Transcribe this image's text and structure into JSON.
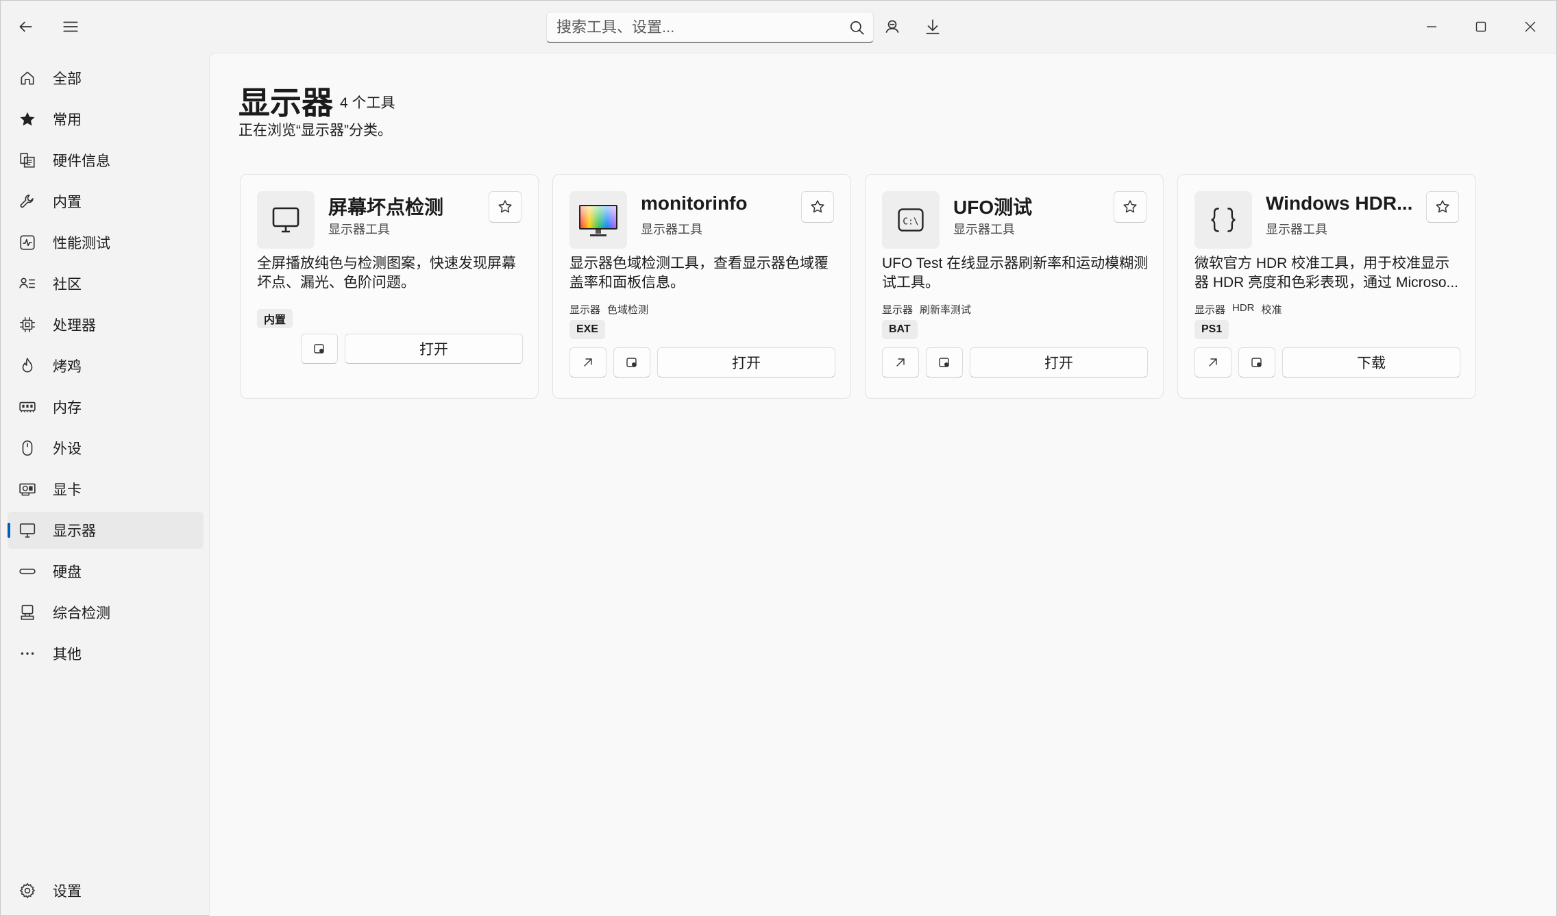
{
  "search": {
    "placeholder": "搜索工具、设置..."
  },
  "sidebar": {
    "items": [
      {
        "label": "全部",
        "icon": "home-icon"
      },
      {
        "label": "常用",
        "icon": "star-icon"
      },
      {
        "label": "硬件信息",
        "icon": "hardware-info-icon"
      },
      {
        "label": "内置",
        "icon": "wrench-icon"
      },
      {
        "label": "性能测试",
        "icon": "pulse-icon"
      },
      {
        "label": "社区",
        "icon": "community-icon"
      },
      {
        "label": "处理器",
        "icon": "cpu-icon"
      },
      {
        "label": "烤鸡",
        "icon": "flame-icon"
      },
      {
        "label": "内存",
        "icon": "memory-icon"
      },
      {
        "label": "外设",
        "icon": "mouse-icon"
      },
      {
        "label": "显卡",
        "icon": "gpu-icon"
      },
      {
        "label": "显示器",
        "icon": "monitor-icon",
        "active": true
      },
      {
        "label": "硬盘",
        "icon": "disk-icon"
      },
      {
        "label": "综合检测",
        "icon": "diagnostics-icon"
      },
      {
        "label": "其他",
        "icon": "more-icon"
      }
    ],
    "settings_label": "设置"
  },
  "main": {
    "title": "显示器",
    "count": "4 个工具",
    "subtitle": "正在浏览“显示器”分类。",
    "cards": [
      {
        "title": "屏幕坏点检测",
        "category": "显示器工具",
        "description": "全屏播放纯色与检测图案，快速发现屏幕坏点、漏光、色阶问题。",
        "tags": [],
        "badge": "内置",
        "action": "打开",
        "icon": "monitor-outline-icon"
      },
      {
        "title": "monitorinfo",
        "category": "显示器工具",
        "description": "显示器色域检测工具，查看显示器色域覆盖率和面板信息。",
        "tags": [
          "显示器",
          "色域检测"
        ],
        "badge": "EXE",
        "action": "打开",
        "icon": "color-monitor-icon"
      },
      {
        "title": "UFO测试",
        "category": "显示器工具",
        "description": "UFO Test 在线显示器刷新率和运动模糊测试工具。",
        "tags": [
          "显示器",
          "刷新率测试"
        ],
        "badge": "BAT",
        "action": "打开",
        "icon": "terminal-icon"
      },
      {
        "title": "Windows HDR...",
        "category": "显示器工具",
        "description": "微软官方 HDR 校准工具，用于校准显示器 HDR 亮度和色彩表现，通过 Microso...",
        "tags": [
          "显示器",
          "HDR",
          "校准"
        ],
        "badge": "PS1",
        "action": "下载",
        "icon": "braces-icon"
      }
    ]
  }
}
